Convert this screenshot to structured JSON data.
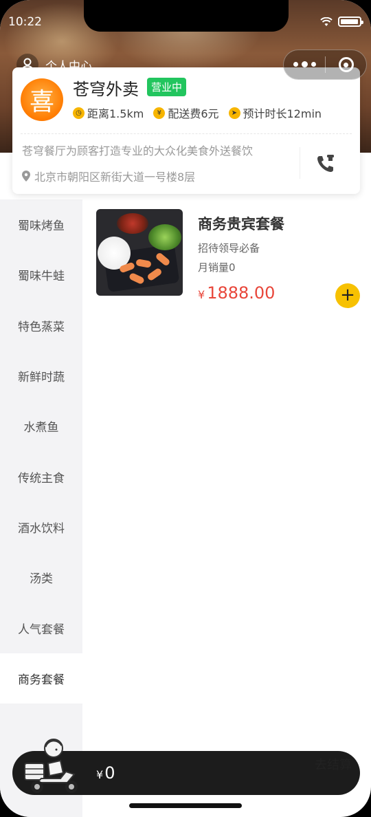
{
  "status": {
    "time": "10:22"
  },
  "nav": {
    "user_center": "个人中心"
  },
  "shop": {
    "logo_char": "喜",
    "name": "苍穹外卖",
    "status": "营业中",
    "distance": "距离1.5km",
    "delivery_fee": "配送费6元",
    "eta": "预计时长12min",
    "description": "苍穹餐厅为顾客打造专业的大众化美食外送餐饮",
    "address": "北京市朝阳区新街大道一号楼8层"
  },
  "categories": [
    "蜀味烤鱼",
    "蜀味牛蛙",
    "特色蒸菜",
    "新鲜时蔬",
    "水煮鱼",
    "传统主食",
    "酒水饮料",
    "汤类",
    "人气套餐",
    "商务套餐"
  ],
  "active_category_index": 9,
  "dishes": [
    {
      "name": "商务贵宾套餐",
      "desc": "招待领导必备",
      "sales": "月销量0",
      "currency": "¥",
      "price": "1888.00"
    }
  ],
  "cart": {
    "currency": "¥",
    "total": "0",
    "checkout_label": "去结算"
  },
  "colors": {
    "accent": "#f7c102",
    "open_badge": "#22c55e",
    "price": "#e8463a",
    "cart_bg": "#1c1c1c"
  }
}
